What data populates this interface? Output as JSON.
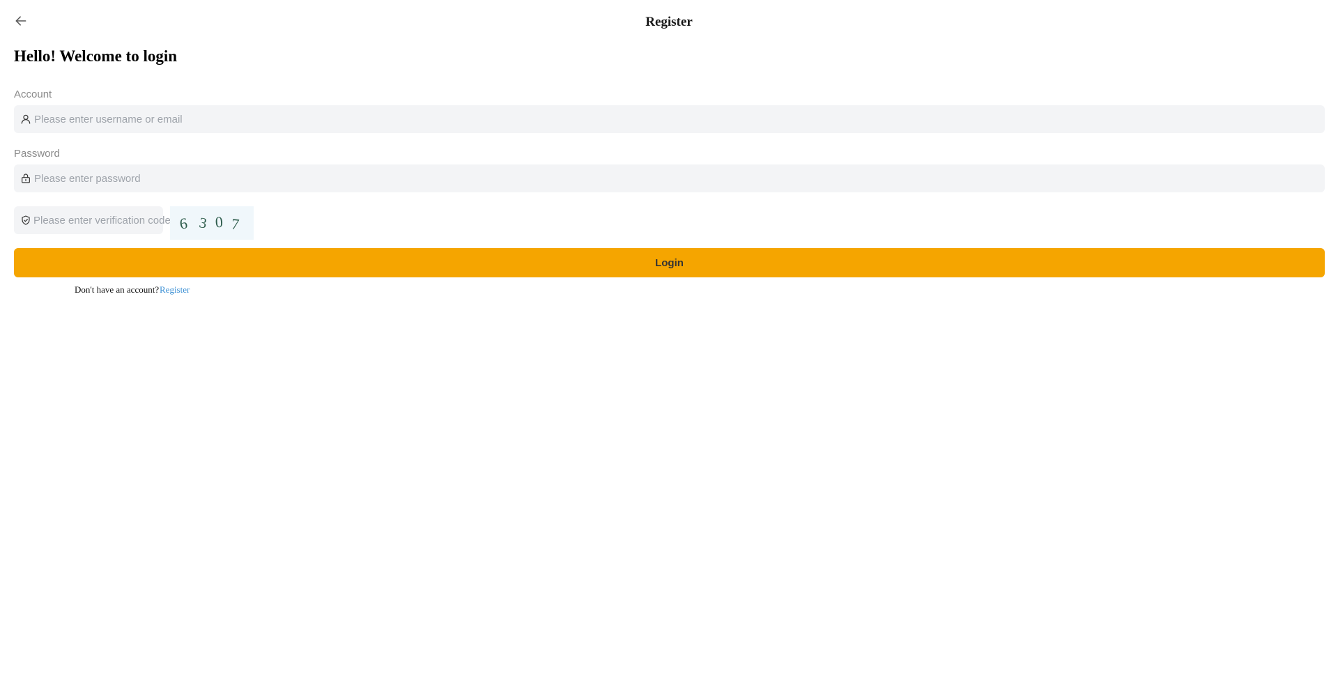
{
  "header": {
    "back_icon": "arrow-left-icon",
    "title": "Register"
  },
  "main": {
    "heading": "Hello! Welcome to login"
  },
  "form": {
    "account": {
      "label": "Account",
      "icon": "user-icon",
      "placeholder": "Please enter username or email",
      "value": ""
    },
    "password": {
      "label": "Password",
      "icon": "lock-icon",
      "placeholder": "Please enter password",
      "value": ""
    },
    "captcha": {
      "icon": "shield-check-icon",
      "placeholder": "Please enter verification code",
      "value": "",
      "image_text": "6307"
    },
    "login_label": "Login"
  },
  "footer": {
    "prompt": "Don't have an account?",
    "register_link": "Register"
  },
  "colors": {
    "accent": "#f5a500",
    "link": "#3a8fd4",
    "input_bg": "#f3f4f6"
  }
}
